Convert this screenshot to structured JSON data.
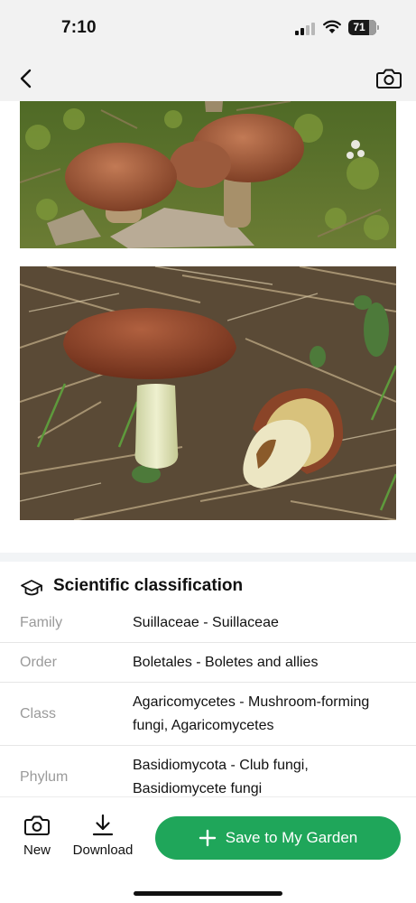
{
  "status_bar": {
    "time": "7:10",
    "battery_level": "71",
    "battery_fraction": 0.71,
    "signal_bars_active": 2,
    "signal_bars_total": 4
  },
  "nav_bar": {
    "back_icon": "chevron-left-icon",
    "right_icon": "camera-icon"
  },
  "gallery": {
    "photos": [
      {
        "subject": "two-brown-mushrooms-in-moss"
      },
      {
        "subject": "slippery-jack-mushroom-on-pine-needles"
      }
    ]
  },
  "classification": {
    "icon": "graduation-cap-icon",
    "title": "Scientific classification",
    "rows": [
      {
        "label": "Family",
        "value": "Suillaceae - Suillaceae"
      },
      {
        "label": "Order",
        "value": "Boletales - Boletes and allies"
      },
      {
        "label": "Class",
        "value": "Agaricomycetes - Mushroom-forming fungi, Agaricomycetes"
      },
      {
        "label": "Phylum",
        "value": "Basidiomycota - Club fungi, Basidiomycete fungi"
      }
    ]
  },
  "bottom_bar": {
    "new_label": "New",
    "download_label": "Download",
    "save_label": "Save to My Garden"
  },
  "colors": {
    "accent": "#1fa65a",
    "status_bar_bg": "#f2f2f2",
    "muted_label": "#9a9a9a"
  }
}
